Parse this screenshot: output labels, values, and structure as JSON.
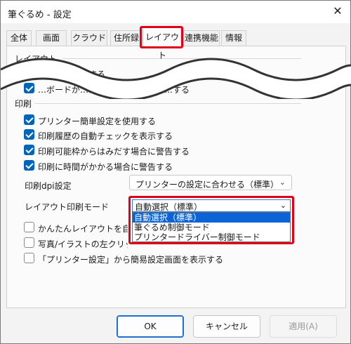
{
  "window": {
    "title": "筆ぐるめ - 設定",
    "close_glyph": "✕"
  },
  "tabs": [
    {
      "label": "全体"
    },
    {
      "label": "画面"
    },
    {
      "label": "クラウド"
    },
    {
      "label": "住所録"
    },
    {
      "label": "レイアウト",
      "active": true
    },
    {
      "label": "連携機能"
    },
    {
      "label": "情報"
    }
  ],
  "layout_group": {
    "label": "レイアウト",
    "items": [
      {
        "label": "領域枠を表示する",
        "checked": true
      },
      {
        "label": "…ボードが…から入力欄と設…ニ…する",
        "checked": true
      }
    ]
  },
  "print_group": {
    "label": "印刷",
    "items": [
      {
        "label": "プリンター簡単設定を使用する",
        "checked": true
      },
      {
        "label": "印刷履歴の自動チェックを表示する",
        "checked": true
      },
      {
        "label": "印刷可能枠からはみだす場合に警告する",
        "checked": true
      },
      {
        "label": "印刷に時間がかかる場合に警告する",
        "checked": true
      }
    ],
    "dpi_label": "印刷dpi設定",
    "dpi_value": "プリンターの設定に合わせる（標準）",
    "mode_label": "レイアウト印刷モード",
    "mode_value": "自動選択（標準）",
    "mode_options": [
      {
        "label": "自動選択（標準）",
        "selected": true
      },
      {
        "label": "筆ぐるめ制御モード"
      },
      {
        "label": "プリンタードライバー制御モード"
      }
    ],
    "extra_items": [
      {
        "label": "かんたんレイアウトを自動発動",
        "checked": false
      },
      {
        "label": "写真/イラストの左クリックボ…",
        "checked": false
      },
      {
        "label": "「プリンター設定」から簡易設定画面を表示する",
        "checked": false
      }
    ]
  },
  "buttons": {
    "ok": "OK",
    "cancel": "キャンセル",
    "apply": "適用(A)"
  },
  "colors": {
    "highlight": "#e0001a",
    "accent": "#0064b8"
  }
}
